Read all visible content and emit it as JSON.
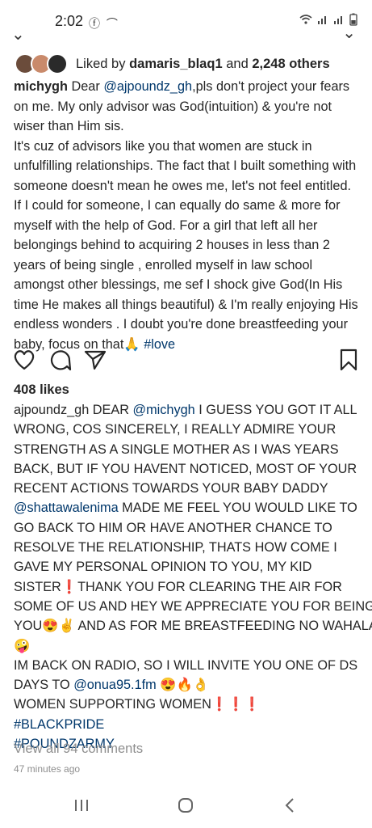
{
  "status_bar": {
    "time": "2:02",
    "left_icons": [
      "facebook-icon",
      "incognito-icon"
    ],
    "right_icons": [
      "wifi-icon",
      "signal-icon",
      "signal-icon",
      "battery-icon"
    ]
  },
  "post": {
    "liked_by_prefix": "Liked by",
    "liked_by_user": "damaris_blaq1",
    "liked_by_and": "and",
    "liked_by_others": "2,248 others",
    "caption": {
      "username": "michygh",
      "text_before_mention": "Dear",
      "mention": "@ajpoundz_gh",
      "text": ",pls don't project your fears on me. My only advisor was God(intuition) & you're not wiser than Him sis.\n It's cuz of advisors like you that women are stuck in unfulfilling relationships. The fact that I built something with someone doesn't mean he owes me, let's not feel entitled. If I could for someone, I can equally do same & more for myself with the help of God. For a girl that left all her belongings behind to acquiring 2 houses in less than 2 years of being single , enrolled myself in law school amongst other blessings, me sef I shock give God(In His time He makes all things beautiful) & I'm really enjoying His endless wonders .  I doubt you're done breastfeeding your baby, focus on that",
      "emoji": "🙏",
      "hashtag": "#love"
    },
    "likes": "408 likes"
  },
  "comment": {
    "username": "ajpoundz_gh",
    "lines": [
      {
        "parts": [
          {
            "t": "ajpoundz_gh ",
            "cls": "user"
          },
          {
            "t": "DEAR "
          },
          {
            "t": "@michygh",
            "cls": "link"
          },
          {
            "t": " I GUESS YOU GOT IT ALL"
          }
        ]
      },
      {
        "parts": [
          {
            "t": "WRONG, COS SINCERELY, I REALLY ADMIRE YOUR"
          }
        ]
      },
      {
        "parts": [
          {
            "t": "STRENGTH AS A SINGLE MOTHER AS I WAS YEARS"
          }
        ]
      },
      {
        "parts": [
          {
            "t": "BACK, BUT IF YOU HAVENT NOTICED, MOST OF YOUR"
          }
        ]
      },
      {
        "parts": [
          {
            "t": "RECENT ACTIONS TOWARDS YOUR BABY DADDY"
          }
        ]
      },
      {
        "parts": [
          {
            "t": "@shattawalenima",
            "cls": "link"
          },
          {
            "t": " MADE ME FEEL YOU WOULD LIKE TO"
          }
        ]
      },
      {
        "parts": [
          {
            "t": "GO BACK TO HIM OR HAVE ANOTHER CHANCE TO"
          }
        ]
      },
      {
        "parts": [
          {
            "t": "RESOLVE THE RELATIONSHIP, THATS HOW COME  I"
          }
        ]
      },
      {
        "parts": [
          {
            "t": "GAVE MY PERSONAL OPINION TO YOU, MY KID"
          }
        ]
      },
      {
        "parts": [
          {
            "t": "SISTER❗THANK YOU FOR CLEARING THE AIR FOR"
          }
        ]
      },
      {
        "parts": [
          {
            "t": "SOME OF US AND HEY WE APPRECIATE YOU FOR BEING"
          }
        ]
      },
      {
        "parts": [
          {
            "t": "YOU😍✌️ AND AS FOR ME BREASTFEEDING NO WAHALA"
          }
        ]
      },
      {
        "parts": [
          {
            "t": "🤪"
          }
        ]
      },
      {
        "parts": [
          {
            "t": "IM BACK ON RADIO, SO I WILL INVITE YOU ONE OF DS"
          }
        ]
      },
      {
        "parts": [
          {
            "t": "DAYS TO "
          },
          {
            "t": "@onua95.1fm",
            "cls": "link"
          },
          {
            "t": " 😍🔥👌"
          }
        ]
      },
      {
        "parts": [
          {
            "t": "WOMEN SUPPORTING WOMEN❗❗❗"
          }
        ]
      },
      {
        "parts": [
          {
            "t": "#BLACKPRIDE",
            "cls": "link"
          }
        ]
      },
      {
        "parts": [
          {
            "t": "#POUNDZARMY",
            "cls": "link"
          }
        ]
      }
    ]
  },
  "view_all_comments": "View all 94 comments",
  "time_ago": "47 minutes ago",
  "colors": {
    "link": "#00376b",
    "muted": "#8e8e8e",
    "text": "#262626",
    "alert": "#e0142a"
  }
}
